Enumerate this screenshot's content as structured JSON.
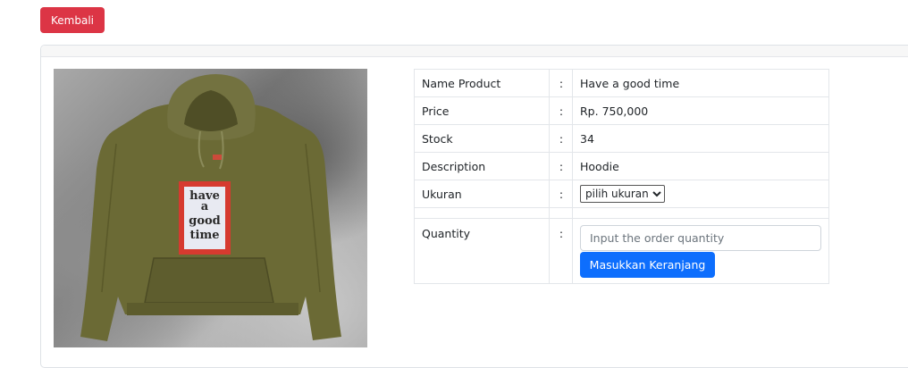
{
  "back_button": {
    "label": "Kembali"
  },
  "product_image": {
    "print_text": [
      "have",
      "a",
      "good",
      "time"
    ]
  },
  "details": {
    "name": {
      "label": "Name Product",
      "sep": ":",
      "value": "Have a good time"
    },
    "price": {
      "label": "Price",
      "sep": ":",
      "value": "Rp. 750,000"
    },
    "stock": {
      "label": "Stock",
      "sep": ":",
      "value": "34"
    },
    "description": {
      "label": "Description",
      "sep": ":",
      "value": "Hoodie"
    },
    "size": {
      "label": "Ukuran",
      "sep": ":",
      "selected": "pilih ukuran"
    },
    "quantity": {
      "label": "Quantity",
      "sep": ":",
      "value": "",
      "placeholder": "Input the order quantity",
      "button_label": "Masukkan Keranjang"
    }
  },
  "colors": {
    "danger": "#dc3545",
    "primary": "#0d6efd",
    "hoodie": "#6b6a35",
    "print_red": "#d63a2f"
  },
  "icons": {
    "select_arrow": "chevron-down-icon"
  }
}
